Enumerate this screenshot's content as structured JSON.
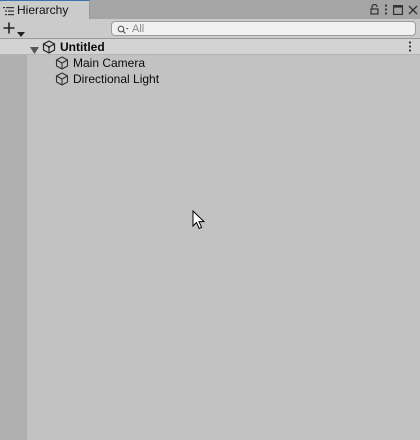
{
  "window": {
    "tab_title": "Hierarchy",
    "tab_icon": "hierarchy-list-icon",
    "buttons": [
      "lock-icon",
      "more-vertical-icon",
      "maximize-icon",
      "close-icon"
    ]
  },
  "toolbar": {
    "create_icon": "plus-icon",
    "dropdown_icon": "caret-down-icon",
    "search": {
      "placeholder": "All",
      "value": "",
      "icon": "search-icon"
    }
  },
  "scene": {
    "name": "Untitled",
    "expanded": true,
    "icon": "unity-scene-icon",
    "menu_icon": "more-vertical-icon"
  },
  "objects": [
    {
      "name": "Main Camera",
      "icon": "cube-icon"
    },
    {
      "name": "Directional Light",
      "icon": "cube-icon"
    }
  ],
  "colors": {
    "panel_bg": "#c2c2c2",
    "tab_active_bg": "#cbcbcb",
    "tab_accent": "#3a72b0",
    "gutter": "#b0b0b0",
    "scene_header_bg": "#d3d3d3"
  }
}
